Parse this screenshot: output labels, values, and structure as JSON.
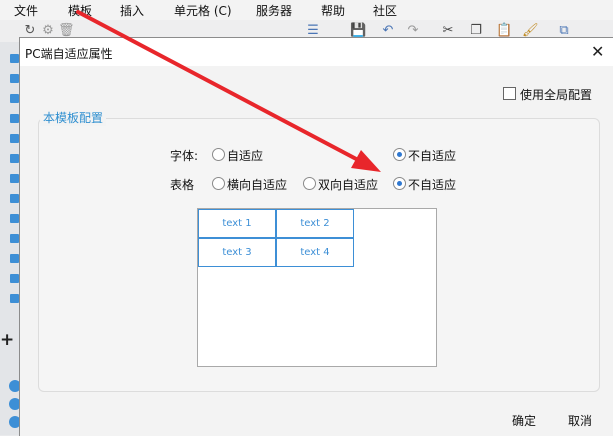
{
  "menubar": {
    "items": [
      "文件",
      "模板",
      "插入",
      "单元格 (C)",
      "服务器",
      "帮助",
      "社区"
    ]
  },
  "dialog": {
    "title": "PC端自适应属性",
    "use_global_label": "使用全局配置",
    "group_title": "本模板配置",
    "font_row": {
      "label": "字体:",
      "options": [
        "自适应",
        "不自适应"
      ],
      "selected": "不自适应"
    },
    "table_row": {
      "label": "表格",
      "options": [
        "横向自适应",
        "双向自适应",
        "不自适应"
      ],
      "selected": "不自适应"
    },
    "preview_cells": [
      "text 1",
      "text 2",
      "text 3",
      "text 4"
    ],
    "ok_label": "确定",
    "cancel_label": "取消"
  },
  "colors": {
    "accent": "#2f8fd0",
    "arrow": "#e8262b"
  }
}
